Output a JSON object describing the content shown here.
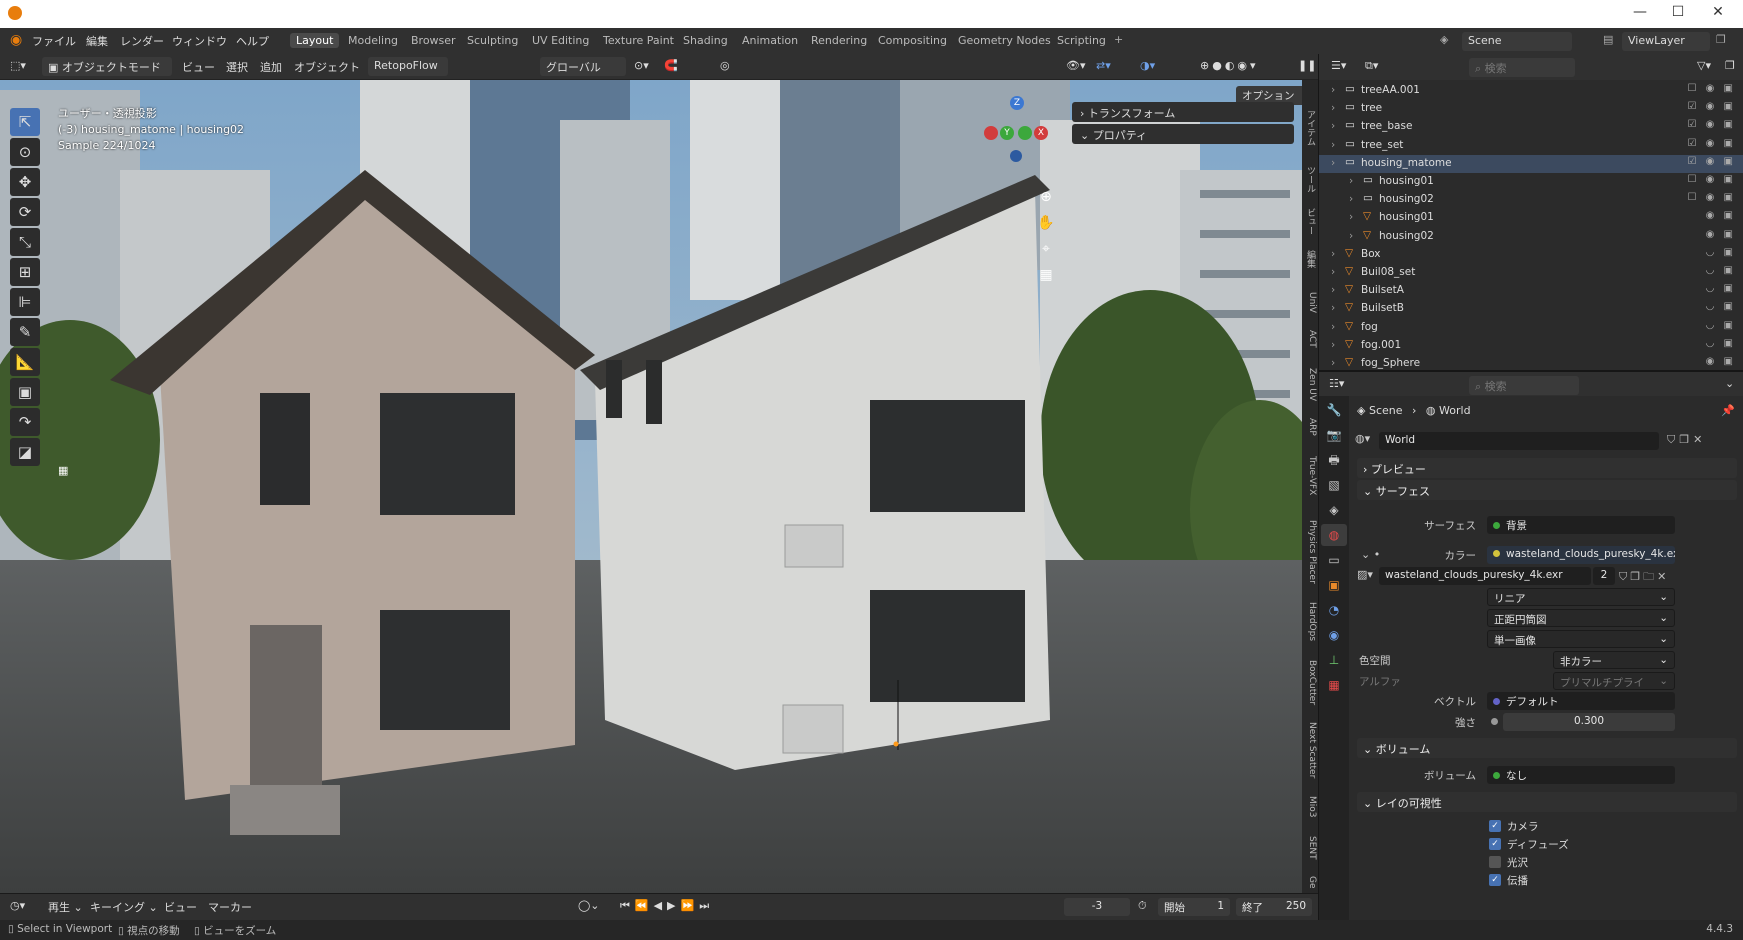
{
  "titlebar": {
    "minimize": "—",
    "maximize": "☐",
    "close": "✕"
  },
  "menu": [
    "ファイル",
    "編集",
    "レンダー",
    "ウィンドウ",
    "ヘルプ"
  ],
  "workspaces": [
    "Layout",
    "Modeling",
    "Browser",
    "Sculpting",
    "UV Editing",
    "Texture Paint",
    "Shading",
    "Animation",
    "Rendering",
    "Compositing",
    "Geometry Nodes",
    "Scripting"
  ],
  "active_workspace": "Layout",
  "scene_name": "Scene",
  "view_layer": "ViewLayer",
  "viewport_header": {
    "mode": "オブジェクトモード",
    "menus": [
      "ビュー",
      "選択",
      "追加",
      "オブジェクト"
    ],
    "addon": "RetopoFlow",
    "transform": "グローバル",
    "options": "オプション"
  },
  "viewport_overlay": {
    "view_name": "ユーザー・透視投影",
    "collection": "(-3) housing_matome | housing02",
    "sample": "Sample 224/1024"
  },
  "gizmo": {
    "x": "X",
    "y": "Y",
    "z": "Z"
  },
  "n_panel": {
    "transform": "トランスフォーム",
    "properties": "プロパティ"
  },
  "side_tabs": [
    "アイテム",
    "ツール",
    "ビュー",
    "編集",
    "UniV",
    "ACT",
    "Zen UV",
    "ARP",
    "True-VFX",
    "Physics Placer",
    "HardOps",
    "BoxCutter",
    "Next Scatter",
    "Mio3",
    "SENT",
    "Ge"
  ],
  "outliner": {
    "search_placeholder": "検索",
    "rows": [
      {
        "name": "treeAA.001",
        "indent": 0,
        "type": "collection",
        "vis": "☐ ◉ ▣"
      },
      {
        "name": "tree",
        "indent": 0,
        "type": "collection",
        "vis": "☑ ◉ ▣"
      },
      {
        "name": "tree_base",
        "indent": 0,
        "type": "collection",
        "vis": "☑ ◉ ▣"
      },
      {
        "name": "tree_set",
        "indent": 0,
        "type": "collection",
        "vis": "☑ ◉ ▣"
      },
      {
        "name": "housing_matome",
        "indent": 0,
        "type": "collection",
        "vis": "☑ ◉ ▣"
      },
      {
        "name": "housing01",
        "indent": 1,
        "type": "collection",
        "vis": "☐ ◉ ▣"
      },
      {
        "name": "housing02",
        "indent": 1,
        "type": "collection",
        "vis": "☐ ◉ ▣"
      },
      {
        "name": "housing01",
        "indent": 1,
        "type": "object",
        "vis": "◉ ▣"
      },
      {
        "name": "housing02",
        "indent": 1,
        "type": "object",
        "vis": "◉ ▣"
      },
      {
        "name": "Box",
        "indent": 0,
        "type": "object",
        "vis": "◡ ▣"
      },
      {
        "name": "Buil08_set",
        "indent": 0,
        "type": "object",
        "vis": "◡ ▣"
      },
      {
        "name": "BuilsetA",
        "indent": 0,
        "type": "object",
        "vis": "◡ ▣"
      },
      {
        "name": "BuilsetB",
        "indent": 0,
        "type": "object",
        "vis": "◡ ▣"
      },
      {
        "name": "fog",
        "indent": 0,
        "type": "object",
        "vis": "◡ ▣"
      },
      {
        "name": "fog.001",
        "indent": 0,
        "type": "object",
        "vis": "◡ ▣"
      },
      {
        "name": "fog_Sphere",
        "indent": 0,
        "type": "object",
        "vis": "◉ ▣"
      }
    ]
  },
  "properties": {
    "search_placeholder": "検索",
    "breadcrumb": [
      "Scene",
      "World"
    ],
    "world_name": "World",
    "sections": {
      "preview": "プレビュー",
      "surface": "サーフェス",
      "volume": "ボリューム",
      "ray_visibility": "レイの可視性"
    },
    "surface_label": "サーフェス",
    "surface_value": "背景",
    "color_label": "カラー",
    "color_value": "wasteland_clouds_puresky_4k.exr",
    "image_name": "wasteland_clouds_puresky_4k.exr",
    "image_users": "2",
    "interpolation": "リニア",
    "projection": "正距円筒図",
    "source": "単一画像",
    "colorspace_label": "色空間",
    "colorspace_value": "非カラー",
    "alpha_label": "アルファ",
    "alpha_value": "プリマルチプライ",
    "vector_label": "ベクトル",
    "vector_value": "デフォルト",
    "strength_label": "強さ",
    "strength_value": "0.300",
    "volume_label": "ボリューム",
    "volume_value": "なし",
    "ray_items": [
      {
        "label": "カメラ",
        "checked": true
      },
      {
        "label": "ディフューズ",
        "checked": true
      },
      {
        "label": "光沢",
        "checked": false
      },
      {
        "label": "伝播",
        "checked": true
      }
    ]
  },
  "timeline": {
    "menus": [
      "再生",
      "キーイング",
      "ビュー",
      "マーカー"
    ],
    "current_frame": "-3",
    "start_label": "開始",
    "start_value": "1",
    "end_label": "終了",
    "end_value": "250"
  },
  "statusbar": {
    "items": [
      "Select in Viewport",
      "視点の移動",
      "ビューをズーム"
    ],
    "version": "4.4.3"
  },
  "colors": {
    "accent": "#4772b3",
    "blender_orange": "#e87d0d",
    "x_axis": "#d23c3c",
    "y_axis": "#3ca83c",
    "z_axis": "#3c78d2"
  }
}
